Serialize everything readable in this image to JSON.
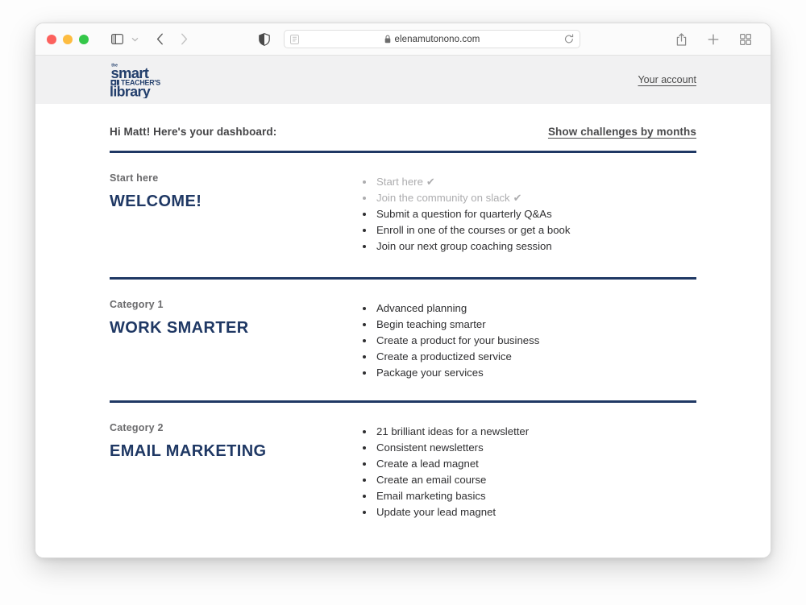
{
  "browser": {
    "url": "elenamutonono.com",
    "lock_icon": "lock-icon",
    "reader_icon": "reader-view-icon",
    "reload_icon": "reload-icon",
    "sidebar_icon": "sidebar-toggle-icon",
    "chevron_icon": "chevron-down-icon",
    "back_icon": "back-arrow-icon",
    "forward_icon": "forward-arrow-icon",
    "shield_icon": "privacy-shield-icon",
    "share_icon": "share-icon",
    "newtab_icon": "plus-icon",
    "tabs_icon": "tab-overview-icon"
  },
  "site_header": {
    "logo_the": "the",
    "logo_smart": "smart",
    "logo_teachers": "TEACHER'S",
    "logo_library": "library",
    "account_label": "Your account"
  },
  "dashboard": {
    "greeting": "Hi Matt! Here's your dashboard:",
    "toggle_label": "Show challenges by months",
    "accent_color": "#1f3864",
    "sections": [
      {
        "label": "Start here",
        "title": "WELCOME!",
        "items": [
          {
            "text": "Start here",
            "done": true,
            "check": "✔"
          },
          {
            "text": "Join the community on slack",
            "done": true,
            "check": "✔"
          },
          {
            "text": "Submit a question for quarterly Q&As",
            "done": false,
            "check": ""
          },
          {
            "text": "Enroll in one of the courses or get a book",
            "done": false,
            "check": ""
          },
          {
            "text": "Join our next group coaching session",
            "done": false,
            "check": ""
          }
        ]
      },
      {
        "label": "Category 1",
        "title": "WORK SMARTER",
        "items": [
          {
            "text": "Advanced planning",
            "done": false,
            "check": ""
          },
          {
            "text": "Begin teaching smarter",
            "done": false,
            "check": ""
          },
          {
            "text": "Create a product for your business",
            "done": false,
            "check": ""
          },
          {
            "text": "Create a productized service",
            "done": false,
            "check": ""
          },
          {
            "text": "Package your services",
            "done": false,
            "check": ""
          }
        ]
      },
      {
        "label": "Category 2",
        "title": "EMAIL MARKETING",
        "items": [
          {
            "text": "21 brilliant ideas for a newsletter",
            "done": false,
            "check": ""
          },
          {
            "text": "Consistent newsletters",
            "done": false,
            "check": ""
          },
          {
            "text": "Create a lead magnet",
            "done": false,
            "check": ""
          },
          {
            "text": "Create an email course",
            "done": false,
            "check": ""
          },
          {
            "text": "Email marketing basics",
            "done": false,
            "check": ""
          },
          {
            "text": "Update your lead magnet",
            "done": false,
            "check": ""
          }
        ]
      }
    ]
  }
}
